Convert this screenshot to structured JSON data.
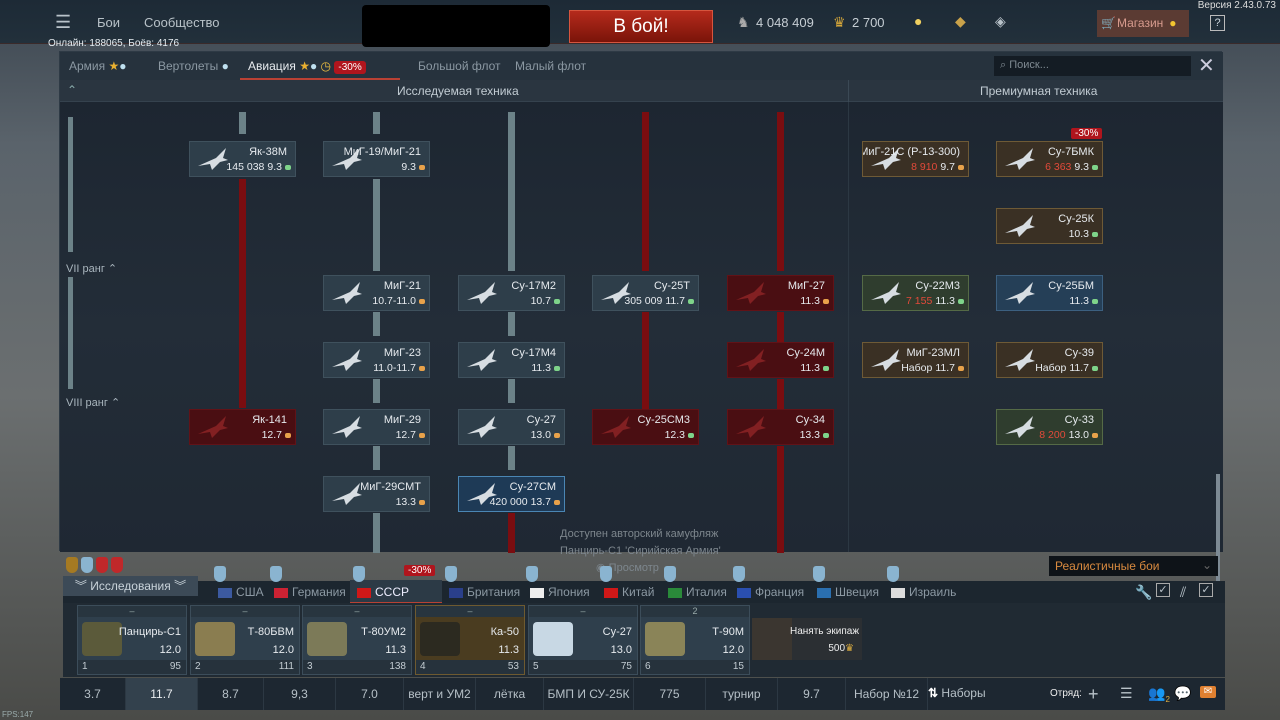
{
  "topbar": {
    "menu_icon": "hamburger-icon",
    "battles": "Бои",
    "community": "Сообщество",
    "battle_button": "В бой!",
    "silver_lions": "4 048 409",
    "golden_eagles": "2 700",
    "shop": "Магазин",
    "help": "?",
    "version": "Версия 2.43.0.73",
    "online": "Онлайн: 188065, Боёв: 4176"
  },
  "tabs": [
    {
      "label": "Армия"
    },
    {
      "label": "Вертолеты"
    },
    {
      "label": "Авиация",
      "discount": "-30%"
    },
    {
      "label": "Большой флот"
    },
    {
      "label": "Малый флот"
    }
  ],
  "search": {
    "placeholder": "Поиск..."
  },
  "tree": {
    "researched_header": "Исследуемая техника",
    "premium_header": "Премиумная техника",
    "ranks": [
      "VII ранг",
      "VIII ранг"
    ],
    "cards": [
      {
        "name": "Як-38М",
        "price": "145 038",
        "br": "9.3",
        "type": "attacker",
        "state": "normal"
      },
      {
        "name": "МиГ-19/МиГ-21",
        "br": "9.3",
        "type": "fighter",
        "state": "normal"
      },
      {
        "name": "МиГ-21",
        "br": "10.7-11.0",
        "type": "fighter",
        "state": "normal"
      },
      {
        "name": "МиГ-23",
        "br": "11.0-11.7",
        "type": "fighter",
        "state": "normal"
      },
      {
        "name": "МиГ-29",
        "br": "12.7",
        "type": "fighter",
        "state": "normal"
      },
      {
        "name": "МиГ-29СМТ",
        "br": "13.3",
        "type": "fighter",
        "state": "normal"
      },
      {
        "name": "Су-17М2",
        "br": "10.7",
        "type": "attacker",
        "state": "normal"
      },
      {
        "name": "Су-17М4",
        "br": "11.3",
        "type": "attacker",
        "state": "normal"
      },
      {
        "name": "Су-27",
        "br": "13.0",
        "type": "fighter",
        "state": "normal"
      },
      {
        "name": "Су-27СМ",
        "price": "420 000",
        "br": "13.7",
        "type": "fighter",
        "state": "sel"
      },
      {
        "name": "Су-25Т",
        "price": "305 009",
        "br": "11.7",
        "type": "attacker",
        "state": "normal"
      },
      {
        "name": "Су-25СМ3",
        "br": "12.3",
        "type": "attacker",
        "state": "locked"
      },
      {
        "name": "МиГ-27",
        "br": "11.3",
        "type": "fighter",
        "state": "locked"
      },
      {
        "name": "Су-24М",
        "br": "11.3",
        "type": "attacker",
        "state": "locked"
      },
      {
        "name": "Су-34",
        "br": "13.3",
        "type": "attacker",
        "state": "locked"
      },
      {
        "name": "Як-141",
        "br": "12.7",
        "type": "fighter",
        "state": "locked"
      },
      {
        "name": "МиГ-21С (Р-13-300)",
        "price": "8 910",
        "br": "9.7",
        "type": "fighter",
        "state": "prem"
      },
      {
        "name": "Су-7БМК",
        "price": "6 363",
        "br": "9.3",
        "type": "attacker",
        "state": "prem",
        "discount": "-30%"
      },
      {
        "name": "Су-25К",
        "br": "10.3",
        "type": "attacker",
        "state": "prem"
      },
      {
        "name": "Су-22М3",
        "price": "7 155",
        "br": "11.3",
        "type": "attacker",
        "state": "green"
      },
      {
        "name": "Су-25БМ",
        "br": "11.3",
        "type": "attacker",
        "state": "blue"
      },
      {
        "name": "МиГ-23МЛ",
        "price": "Набор",
        "br": "11.7",
        "type": "fighter",
        "state": "prem"
      },
      {
        "name": "Су-39",
        "price": "Набор",
        "br": "11.7",
        "type": "attacker",
        "state": "prem"
      },
      {
        "name": "Су-33",
        "price": "8 200",
        "br": "13.0",
        "type": "fighter",
        "state": "green"
      }
    ],
    "notice": [
      "Доступен авторский камуфляж",
      "Панцирь-С1 'Сирийская Армия'"
    ],
    "notice_view": "Просмотр"
  },
  "colors": {
    "fighter": "#e8a24a",
    "attacker": "#7ed48a",
    "locked": "#4a0e12",
    "accent": "#b94134"
  },
  "game_mode": "Реалистичные бои",
  "research_button": "Исследования",
  "nations": [
    "США",
    "Германия",
    "СССР",
    "Британия",
    "Япония",
    "Китай",
    "Италия",
    "Франция",
    "Швеция",
    "Израиль"
  ],
  "nations_discount": "-30%",
  "crew": [
    {
      "name": "Панцирь-С1",
      "br": "12.0",
      "num": "1",
      "pts": "95",
      "top": "–"
    },
    {
      "name": "Т-80БВМ",
      "br": "12.0",
      "num": "2",
      "pts": "111",
      "top": "–"
    },
    {
      "name": "Т-80УМ2",
      "br": "11.3",
      "num": "3",
      "pts": "138",
      "top": "–"
    },
    {
      "name": "Ка-50",
      "br": "11.3",
      "num": "4",
      "pts": "53",
      "top": "–"
    },
    {
      "name": "Су-27",
      "br": "13.0",
      "num": "5",
      "pts": "75",
      "top": "–"
    },
    {
      "name": "Т-90М",
      "br": "12.0",
      "num": "6",
      "pts": "15",
      "top": "2"
    }
  ],
  "hire": {
    "label": "Нанять экипаж",
    "price": "500"
  },
  "presets": [
    "3.7",
    "11.7",
    "8.7",
    "9,3",
    "7.0",
    "верт и УМ2",
    "лётка",
    "БМП И СУ-25К",
    "775",
    "турнир",
    "9.7",
    "Набор №12"
  ],
  "presets_button": "Наборы",
  "squad_label": "Отряд:",
  "friends_count": "2",
  "fps": "FPS:147"
}
